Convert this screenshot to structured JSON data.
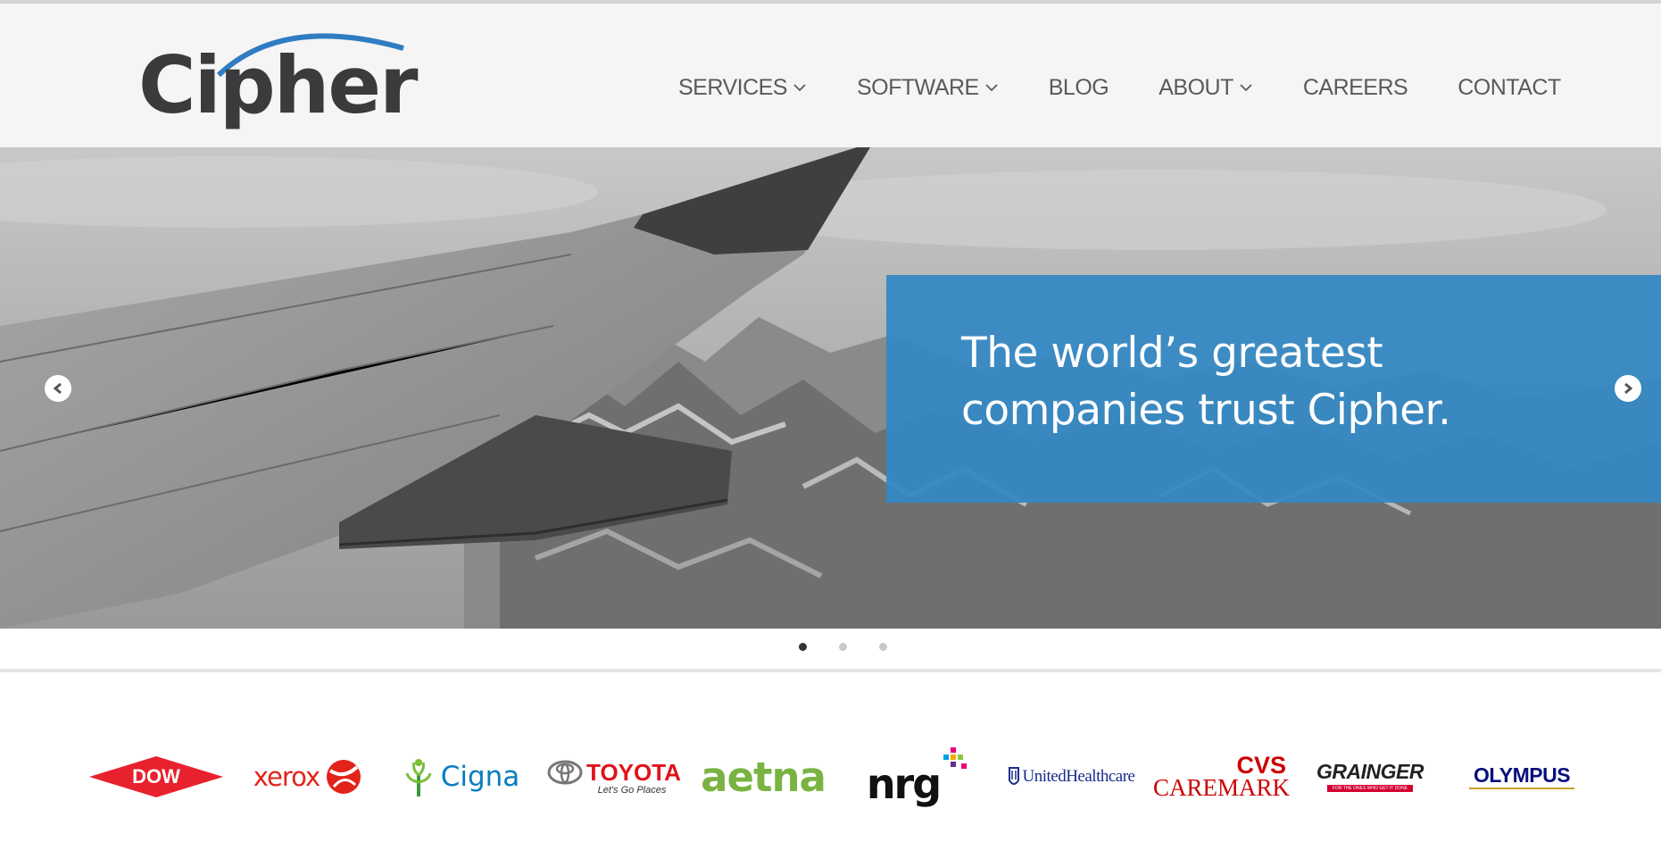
{
  "brand": {
    "name": "Cipher",
    "logo_text": "Cipher",
    "accent": "#2f7cc2",
    "text_color": "#3b3b3d"
  },
  "nav": {
    "items": [
      {
        "label": "SERVICES",
        "has_dropdown": true
      },
      {
        "label": "SOFTWARE",
        "has_dropdown": true
      },
      {
        "label": "BLOG",
        "has_dropdown": false
      },
      {
        "label": "ABOUT",
        "has_dropdown": true
      },
      {
        "label": "CAREERS",
        "has_dropdown": false
      },
      {
        "label": "CONTACT",
        "has_dropdown": false
      }
    ]
  },
  "hero": {
    "caption_line1": "The world’s greatest",
    "caption_line2": "companies trust Cipher.",
    "caption_bg": "#3488c4",
    "prev_icon": "chevron-left-icon",
    "next_icon": "chevron-right-icon",
    "slides_total": 3,
    "active_slide": 1
  },
  "clients": [
    {
      "name": "DOW",
      "color": "#e8212e"
    },
    {
      "name": "xerox",
      "color": "#e2231a"
    },
    {
      "name": "Cigna",
      "color": "#0a7dbf"
    },
    {
      "name": "TOYOTA",
      "tagline": "Let's Go Places",
      "color": "#e0121b"
    },
    {
      "name": "aetna",
      "color": "#7ab342"
    },
    {
      "name": "nrg",
      "color": "#111111"
    },
    {
      "name": "UnitedHealthcare",
      "color": "#1a2c8c"
    },
    {
      "name": "CVS",
      "name2": "CAREMARK",
      "color": "#cc0000"
    },
    {
      "name": "GRAINGER",
      "tagline": "FOR THE ONES WHO GET IT DONE",
      "color": "#222222",
      "accent": "#d50032"
    },
    {
      "name": "OLYMPUS",
      "color": "#08107b",
      "accent": "#c9a227"
    }
  ]
}
